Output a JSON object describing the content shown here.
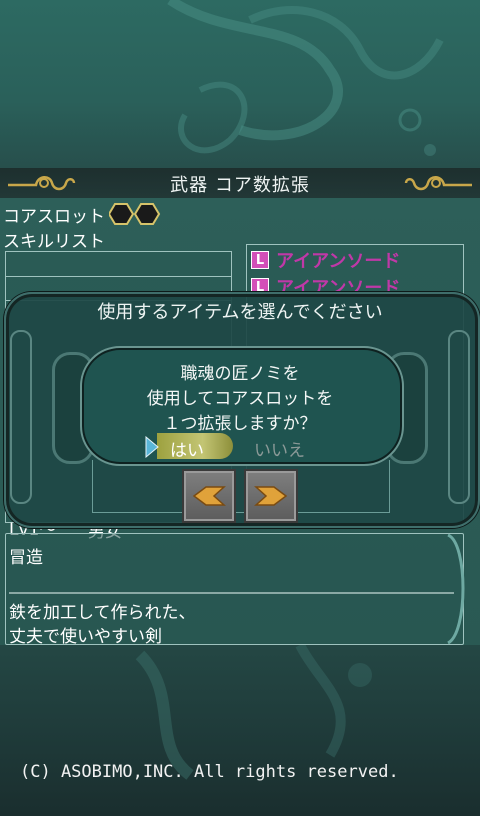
{
  "header": {
    "title": "武器 コア数拡張"
  },
  "core_slot": {
    "label": "コアスロット",
    "slots": 2
  },
  "skill_list": {
    "label": "スキルリスト"
  },
  "item_list": [
    {
      "badge": "L",
      "name": "アイアンソード"
    },
    {
      "badge": "L",
      "name": "アイアンソード"
    }
  ],
  "details": {
    "level": "Lv1～",
    "gender": "男女",
    "maker": "冒造",
    "description_line1": "鉄を加工して作られた、",
    "description_line2": "丈夫で使いやすい剣"
  },
  "outer_dialog": {
    "title": "使用するアイテムを選んでください"
  },
  "confirm_dialog": {
    "line1": "職魂の匠ノミを",
    "line2": "使用してコアスロットを",
    "line3": "１つ拡張しますか？",
    "yes": "はい",
    "no": "いいえ"
  },
  "footer": {
    "copyright": "(C) ASOBIMO,INC. All rights reserved."
  },
  "colors": {
    "item_name": "#c038a8",
    "badge": "#d34fb8",
    "yes_highlight": "#b6b85f",
    "arrow_gold": "#e0a23a"
  },
  "icons": [
    "scroll-ornament-icon",
    "hexagon-slot-icon",
    "cursor-arrow-icon",
    "left-arrow-icon",
    "right-arrow-icon"
  ]
}
